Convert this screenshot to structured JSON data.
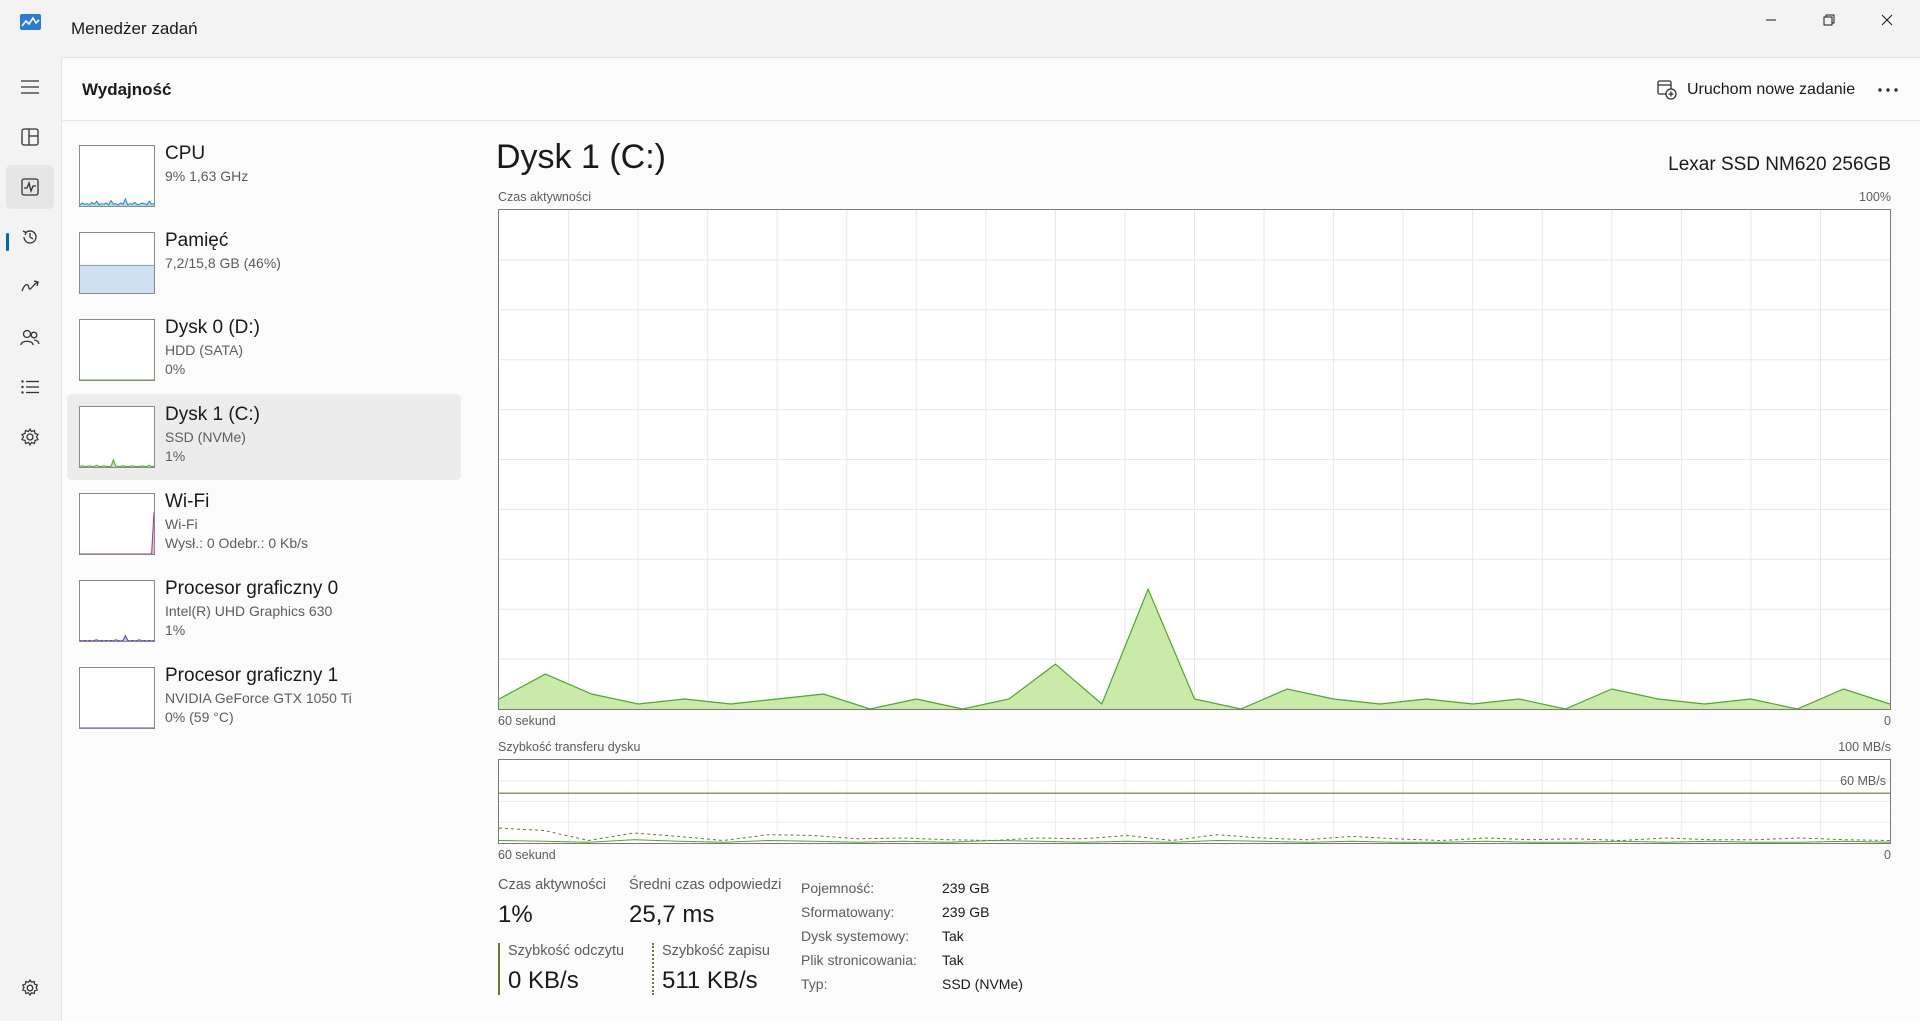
{
  "app": {
    "title": "Menedżer zadań",
    "icon": "task-manager-icon",
    "window_buttons": [
      "minimize-icon",
      "restore-icon",
      "close-icon"
    ]
  },
  "rail": {
    "items": [
      {
        "icon": "hamburger-menu-icon"
      },
      {
        "icon": "processes-icon"
      },
      {
        "icon": "performance-icon",
        "active": true
      },
      {
        "icon": "app-history-icon"
      },
      {
        "icon": "startup-apps-icon"
      },
      {
        "icon": "users-icon"
      },
      {
        "icon": "details-icon"
      },
      {
        "icon": "services-icon"
      }
    ],
    "settings_icon": "gear-icon"
  },
  "header": {
    "title": "Wydajność",
    "run_task_label": "Uruchom nowe zadanie",
    "run_task_icon": "run-task-icon",
    "more_icon": "more-options-icon"
  },
  "devices": [
    {
      "name": "CPU",
      "sub": "9%  1,63 GHz",
      "sub2": "",
      "color": "#1f8ac0",
      "series": [
        2,
        5,
        3,
        4,
        2,
        6,
        3,
        8,
        2,
        4,
        3,
        5,
        2,
        9,
        3,
        4,
        2,
        5,
        3,
        12,
        2,
        4,
        3,
        6,
        2,
        3,
        5,
        4,
        2,
        8,
        3,
        4
      ]
    },
    {
      "name": "Pamięć",
      "sub": "7,2/15,8 GB (46%)",
      "sub2": "",
      "color": "#6fa3d6",
      "series": [
        46,
        46,
        46,
        46,
        46,
        46,
        46,
        46,
        46,
        46,
        46,
        46,
        46,
        46,
        46,
        46,
        46,
        46,
        46,
        46,
        46,
        46,
        46,
        46,
        46,
        46,
        46,
        46,
        46,
        46,
        46,
        46
      ]
    },
    {
      "name": "Dysk 0 (D:)",
      "sub": "HDD (SATA)",
      "sub2": "0%",
      "color": "#4ea72a",
      "series": [
        0,
        0,
        0,
        0,
        0,
        0,
        0,
        0,
        0,
        0,
        0,
        0,
        0,
        0,
        0,
        0,
        0,
        0,
        0,
        0,
        0,
        0,
        0,
        0,
        0,
        0,
        0,
        0,
        0,
        0,
        0,
        0
      ]
    },
    {
      "name": "Dysk 1 (C:)",
      "sub": "SSD (NVMe)",
      "sub2": "1%",
      "color": "#4ea72a",
      "selected": true,
      "series": [
        1,
        2,
        1,
        1,
        2,
        1,
        1,
        3,
        1,
        1,
        2,
        1,
        1,
        1,
        12,
        2,
        1,
        1,
        2,
        1,
        1,
        1,
        2,
        1,
        1,
        1,
        2,
        1,
        1,
        3,
        1,
        1
      ]
    },
    {
      "name": "Wi-Fi",
      "sub": "Wi-Fi",
      "sub2": "Wysł.: 0 Odebr.: 0 Kb/s",
      "color": "#b0347a",
      "series": [
        0,
        0,
        0,
        0,
        0,
        0,
        0,
        0,
        0,
        0,
        0,
        0,
        0,
        0,
        0,
        0,
        0,
        0,
        0,
        0,
        0,
        0,
        0,
        0,
        0,
        0,
        0,
        0,
        0,
        0,
        0,
        70
      ]
    },
    {
      "name": "Procesor graficzny 0",
      "sub": "Intel(R) UHD Graphics 630",
      "sub2": "1%",
      "color": "#6a3fa8",
      "series": [
        1,
        0,
        1,
        0,
        1,
        0,
        1,
        2,
        0,
        1,
        0,
        1,
        0,
        1,
        0,
        2,
        1,
        0,
        1,
        9,
        1,
        0,
        1,
        0,
        1,
        2,
        0,
        1,
        0,
        1,
        0,
        1
      ]
    },
    {
      "name": "Procesor graficzny 1",
      "sub": "NVIDIA GeForce GTX 1050 Ti",
      "sub2": "0%  (59 °C)",
      "color": "#6a3fa8",
      "series": [
        0,
        0,
        0,
        0,
        0,
        0,
        0,
        0,
        0,
        0,
        0,
        0,
        0,
        0,
        0,
        0,
        0,
        0,
        0,
        0,
        0,
        0,
        0,
        0,
        0,
        0,
        0,
        0,
        0,
        0,
        0,
        0
      ]
    }
  ],
  "detail": {
    "title": "Dysk 1 (C:)",
    "model": "Lexar SSD NM620 256GB",
    "activity_chart_label": "Czas aktywności",
    "activity_max": "100%",
    "time_label": "60 sekund",
    "time_end": "0",
    "transfer_chart_label": "Szybkość transferu dysku",
    "transfer_max": "100 MB/s",
    "transfer_line_label": "60 MB/s",
    "time_label2": "60 sekund",
    "time_end2": "0"
  },
  "chart_data": [
    {
      "type": "area",
      "title": "Czas aktywności",
      "xlabel": "60 sekund",
      "ylim": [
        0,
        100
      ],
      "x": [
        60,
        58,
        56,
        54,
        52,
        50,
        48,
        46,
        44,
        42,
        40,
        38,
        36,
        34,
        32,
        30,
        28,
        26,
        24,
        22,
        20,
        18,
        16,
        14,
        12,
        10,
        8,
        6,
        4,
        2,
        0
      ],
      "values": [
        2,
        7,
        3,
        1,
        2,
        1,
        2,
        3,
        0,
        2,
        0,
        2,
        9,
        1,
        24,
        2,
        0,
        4,
        2,
        1,
        2,
        1,
        2,
        0,
        4,
        2,
        1,
        2,
        0,
        4,
        1
      ],
      "color": "#4ea72a",
      "fill": "#c9eaa9",
      "grid": true
    },
    {
      "type": "line",
      "title": "Szybkość transferu dysku",
      "xlabel": "60 sekund",
      "ylim": [
        0,
        100
      ],
      "y_marker": 60,
      "series": [
        {
          "values": [
            18,
            15,
            3,
            12,
            8,
            3,
            10,
            9,
            5,
            6,
            4,
            3,
            6,
            5,
            9,
            3,
            10,
            6,
            4,
            8,
            5,
            3,
            6,
            4,
            5,
            3,
            6,
            4,
            4,
            6,
            4,
            3
          ],
          "color": "#6b7a2a",
          "dash": "3,3"
        },
        {
          "values": [
            3,
            2,
            1,
            4,
            2,
            1,
            3,
            2,
            1,
            2,
            1,
            3,
            2,
            1,
            2,
            1,
            3,
            2,
            1,
            2,
            1,
            1,
            2,
            1,
            1,
            2,
            1,
            2,
            1,
            1,
            2,
            1
          ],
          "color": "#4ea72a",
          "dash": ""
        }
      ]
    }
  ],
  "stats": {
    "active_time_label": "Czas aktywności",
    "active_time_value": "1%",
    "avg_response_label": "Średni czas odpowiedzi",
    "avg_response_value": "25,7 ms",
    "read_speed_label": "Szybkość odczytu",
    "read_speed_value": "0 KB/s",
    "write_speed_label": "Szybkość zapisu",
    "write_speed_value": "511 KB/s"
  },
  "properties": [
    {
      "key": "Pojemność:",
      "value": "239 GB"
    },
    {
      "key": "Sformatowany:",
      "value": "239 GB"
    },
    {
      "key": "Dysk systemowy:",
      "value": "Tak"
    },
    {
      "key": "Plik stronicowania:",
      "value": "Tak"
    },
    {
      "key": "Typ:",
      "value": "SSD (NVMe)"
    }
  ]
}
